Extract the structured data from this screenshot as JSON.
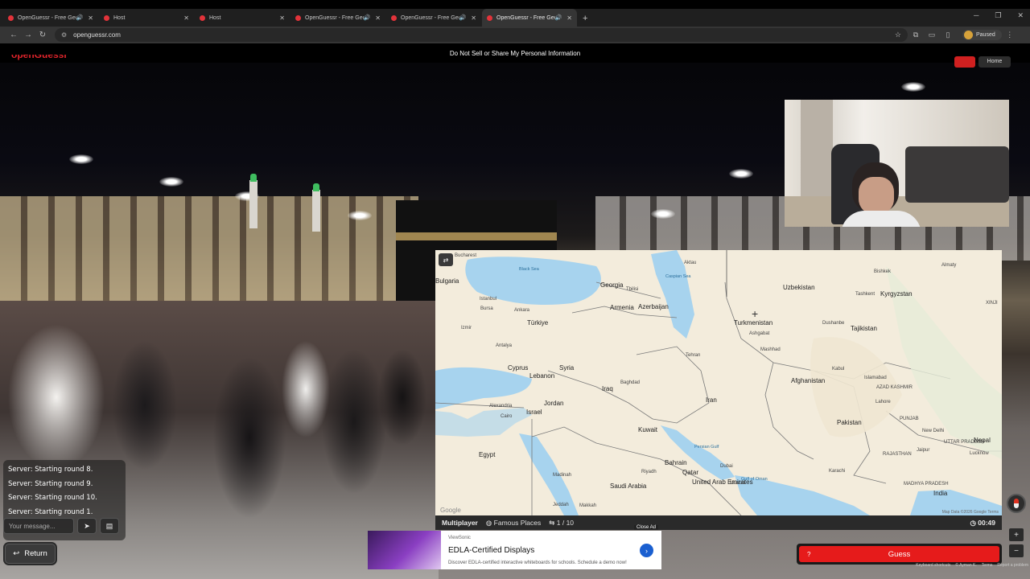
{
  "browser": {
    "tabs": [
      {
        "title": "OpenGuessr - Free GeoGuessr",
        "audio": true,
        "active": false
      },
      {
        "title": "Host",
        "audio": false,
        "active": false
      },
      {
        "title": "Host",
        "audio": false,
        "active": false
      },
      {
        "title": "OpenGuessr - Free GeoGuessr",
        "audio": true,
        "active": false
      },
      {
        "title": "OpenGuessr - Free GeoGuessr",
        "audio": true,
        "active": false
      },
      {
        "title": "OpenGuessr - Free GeoGuessr",
        "audio": true,
        "active": true
      }
    ],
    "url": "openguessr.com",
    "profile_label": "Paused"
  },
  "page": {
    "logo_text": "openGuessr",
    "consent_text": "Do Not Sell or Share My Personal Information",
    "home_label": "Home"
  },
  "chat": {
    "messages": [
      "Server: Starting round 8.",
      "Server: Starting round 9.",
      "Server: Starting round 10.",
      "Server: Starting round 1."
    ],
    "input_placeholder": "Your message...",
    "return_label": "Return"
  },
  "map": {
    "labels": {
      "bucharest": "Bucharest",
      "bulgaria": "Bulgaria",
      "black_sea": "Black Sea",
      "istanbul": "Istanbul",
      "georgia": "Georgia",
      "tbilisi": "Tbilisi",
      "armenia": "Armenia",
      "azerbaijan": "Azerbaijan",
      "aktau": "Aktau",
      "uzbekistan": "Uzbekistan",
      "almaty": "Almaty",
      "bishkek": "Bishkek",
      "kyrgyzstan": "Kyrgyzstan",
      "tashkent": "Tashkent",
      "xinjiang": "XINJI",
      "bursa": "Bursa",
      "ankara": "Ankara",
      "turkiye": "Türkiye",
      "izmir": "Izmir",
      "turkmenistan": "Turkmenistan",
      "ashgabat": "Ashgabat",
      "dushanbe": "Dushanbe",
      "tajikistan": "Tajikistan",
      "antalya": "Antalya",
      "mashhad": "Mashhad",
      "tehran": "Tehran",
      "cyprus": "Cyprus",
      "lebanon": "Lebanon",
      "syria": "Syria",
      "afghanistan": "Afghanistan",
      "kabul": "Kabul",
      "islamabad": "Islamabad",
      "azad_kashmir": "AZAD KASHMIR",
      "baghdad": "Baghdad",
      "iraq": "Iraq",
      "alexandria": "Alexandria",
      "israel": "Israel",
      "cairo": "Cairo",
      "jordan": "Jordan",
      "iran": "Iran",
      "lahore": "Lahore",
      "pakistan": "Pakistan",
      "kuwait": "Kuwait",
      "punjab": "PUNJAB",
      "new_delhi": "New Delhi",
      "egypt": "Egypt",
      "uttar_pradesh": "UTTAR PRADESH",
      "nepal": "Nepal",
      "lucknow": "Lucknow",
      "rajasthan": "RAJASTHAN",
      "jaipur": "Jaipur",
      "bahrain": "Bahrain",
      "riyadh": "Riyadh",
      "qatar": "Qatar",
      "dubai": "Dubai",
      "karachi": "Karachi",
      "madinah": "Madinah",
      "uae": "United Arab Emirates",
      "muscat": "Muscat",
      "saudi_arabia": "Saudi Arabia",
      "madhya_pradesh": "MADHYA PRADESH",
      "india": "India",
      "jeddah": "Jeddah",
      "makkah": "Makkah",
      "caspian": "Caspian Sea",
      "persian_gulf": "Persian Gulf",
      "gulf_of_oman": "Gulf of Oman"
    },
    "google_label": "Google",
    "attribution": "Map Data ©2026 Google  Terms"
  },
  "mapbar": {
    "mode": "Multiplayer",
    "category": "Famous Places",
    "round": "1 / 10",
    "timer": "00:49",
    "close_ad": "Close Ad"
  },
  "ad": {
    "brand": "ViewSonic",
    "title": "EDLA-Certified Displays",
    "description": "Discover EDLA-certified interactive whiteboards for schools. Schedule a demo now!"
  },
  "guess": {
    "label": "Guess",
    "hint": "?"
  },
  "footer": {
    "links": [
      "Keyboard shortcuts",
      "© Ayman K.",
      "Terms",
      "Report a problem"
    ]
  },
  "colors": {
    "guess_red": "#e61b1b",
    "logo_red": "#e0242b",
    "water": "#a7d3ee",
    "land": "#f3ecdc"
  }
}
